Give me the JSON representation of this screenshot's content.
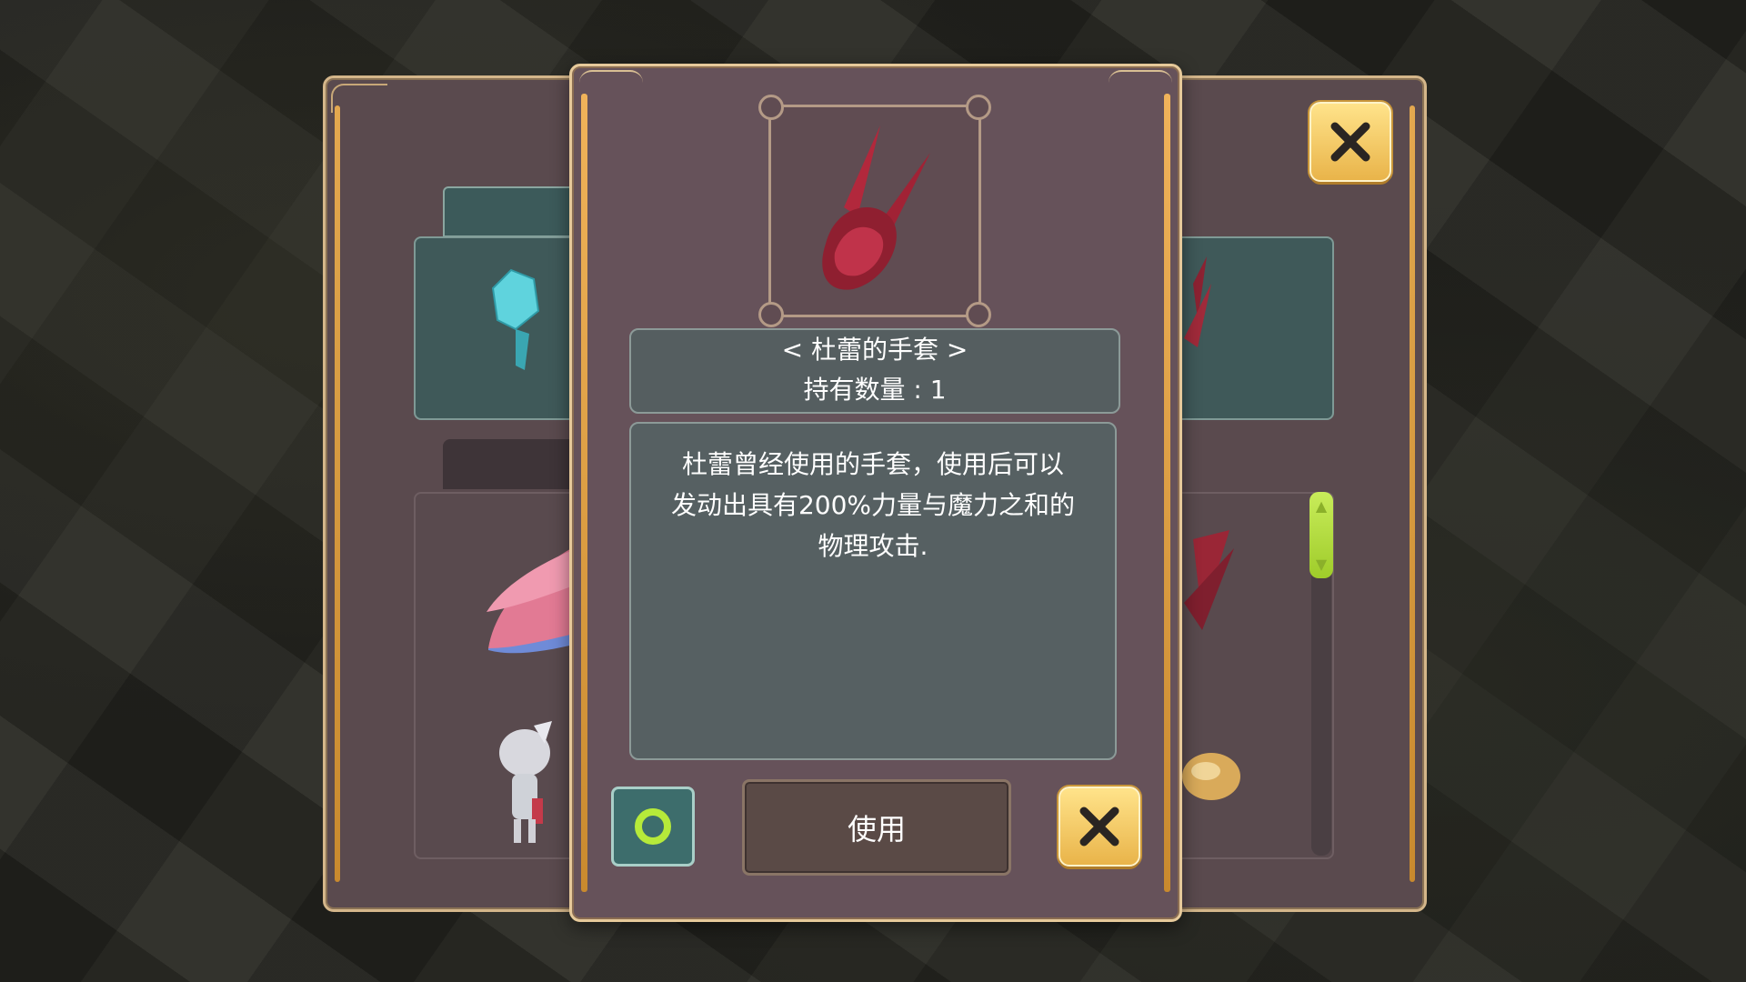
{
  "dialog": {
    "item_name": "< 杜蕾的手套 >",
    "quantity": "持有数量 : 1",
    "description_lines": [
      "杜蕾曾经使用的手套，使用后可以",
      "发动出具有200%力量与魔力之和的",
      "物理攻击."
    ],
    "use_label": "使用"
  },
  "icons": {
    "item": "red-gauntlet-icon",
    "confirm": "green-ring-icon",
    "close": "close-x-icon"
  },
  "colors": {
    "panel": "#66525a",
    "frame_gold": "#e6c99a",
    "close_button": "#f5c860",
    "confirm_ring": "#b6ea3a",
    "scroll_thumb": "#b6e24a"
  }
}
